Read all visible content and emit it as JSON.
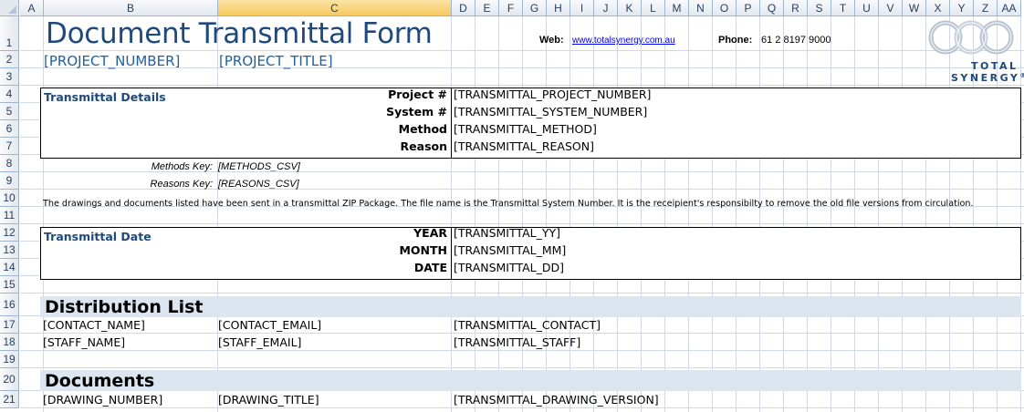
{
  "columns": [
    "A",
    "B",
    "C",
    "D",
    "E",
    "F",
    "G",
    "H",
    "I",
    "J",
    "K",
    "L",
    "M",
    "N",
    "O",
    "P",
    "Q",
    "R",
    "S",
    "T",
    "U",
    "V",
    "W",
    "X",
    "Y",
    "Z",
    "AA"
  ],
  "selected_column": "C",
  "rows": [
    "1",
    "2",
    "3",
    "4",
    "5",
    "6",
    "7",
    "8",
    "9",
    "10",
    "11",
    "12",
    "13",
    "14",
    "15",
    "16",
    "17",
    "18",
    "19",
    "20",
    "21"
  ],
  "header": {
    "title": "Document Transmittal Form",
    "project_number": "[PROJECT_NUMBER]",
    "project_title": "[PROJECT_TITLE]",
    "web_label": "Web:",
    "web_url": "www.totalsynergy.com.au",
    "phone_label": "Phone:",
    "phone_value": "61 2 8197 9000"
  },
  "logo": {
    "line1": "TOTAL",
    "line2": "SYNERGY",
    "mark": "®"
  },
  "transmittal_details": {
    "heading": "Transmittal Details",
    "fields": [
      {
        "label": "Project #",
        "value": "[TRANSMITTAL_PROJECT_NUMBER]"
      },
      {
        "label": "System #",
        "value": "[TRANSMITTAL_SYSTEM_NUMBER]"
      },
      {
        "label": "Method",
        "value": "[TRANSMITTAL_METHOD]"
      },
      {
        "label": "Reason",
        "value": "[TRANSMITTAL_REASON]"
      }
    ]
  },
  "keys": {
    "methods_label": "Methods Key:",
    "methods_value": "[METHODS_CSV]",
    "reasons_label": "Reasons Key:",
    "reasons_value": "[REASONS_CSV]"
  },
  "note": "The drawings and documents listed have been sent in a transmittal ZIP Package. The file name is the Transmittal System Number. It is the receipient's responsibilty to remove the old file versions from circulation.",
  "transmittal_date": {
    "heading": "Transmittal Date",
    "fields": [
      {
        "label": "YEAR",
        "value": "[TRANSMITTAL_YY]"
      },
      {
        "label": "MONTH",
        "value": "[TRANSMITTAL_MM]"
      },
      {
        "label": "DATE",
        "value": "[TRANSMITTAL_DD]"
      }
    ]
  },
  "distribution": {
    "heading": "Distribution List",
    "rows": [
      [
        "[CONTACT_NAME]",
        "[CONTACT_EMAIL]",
        "[TRANSMITTAL_CONTACT]"
      ],
      [
        "[STAFF_NAME]",
        "[STAFF_EMAIL]",
        "[TRANSMITTAL_STAFF]"
      ]
    ]
  },
  "documents": {
    "heading": "Documents",
    "rows": [
      [
        "[DRAWING_NUMBER]",
        "[DRAWING_TITLE]",
        "[TRANSMITTAL_DRAWING_VERSION]"
      ]
    ]
  },
  "colors": {
    "title_blue": "#1f497d",
    "band": "#dce6f1",
    "header_selected": "#f5c95e",
    "gridline": "#d0d7e5"
  }
}
